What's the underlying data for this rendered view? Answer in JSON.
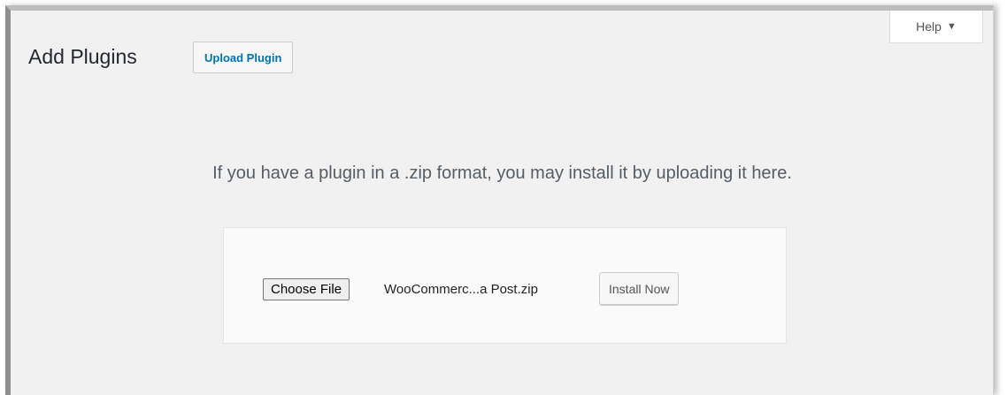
{
  "header": {
    "title": "Add Plugins",
    "upload_label": "Upload Plugin",
    "help_label": "Help",
    "help_caret": "▼"
  },
  "upload": {
    "help_text": "If you have a plugin in a .zip format, you may install it by uploading it here.",
    "choose_file_label": "Choose File",
    "file_name": "WooCommerc...a Post.zip",
    "install_label": "Install Now"
  },
  "colors": {
    "background": "#f1f1f1",
    "link": "#0073aa",
    "text": "#23282d"
  }
}
